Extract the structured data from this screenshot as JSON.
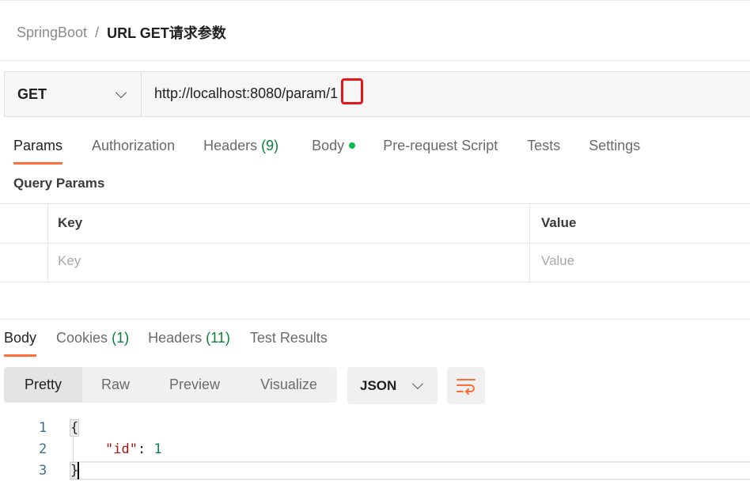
{
  "breadcrumb": {
    "parent": "SpringBoot",
    "separator": "/",
    "current": "URL GET请求参数"
  },
  "request": {
    "method": "GET",
    "url": "http://localhost:8080/param/1"
  },
  "request_tabs": [
    {
      "label": "Params",
      "count": "",
      "active": true
    },
    {
      "label": "Authorization",
      "count": ""
    },
    {
      "label": "Headers",
      "count": "(9)"
    },
    {
      "label": "Body",
      "count": "",
      "dot": true
    },
    {
      "label": "Pre-request Script",
      "count": ""
    },
    {
      "label": "Tests",
      "count": ""
    },
    {
      "label": "Settings",
      "count": ""
    }
  ],
  "query_params": {
    "title": "Query Params",
    "columns": [
      "Key",
      "Value"
    ],
    "placeholders": {
      "key": "Key",
      "value": "Value"
    }
  },
  "response_tabs": [
    {
      "label": "Body",
      "count": "",
      "active": true
    },
    {
      "label": "Cookies",
      "count": "(1)"
    },
    {
      "label": "Headers",
      "count": "(11)"
    },
    {
      "label": "Test Results",
      "count": ""
    }
  ],
  "view_modes": [
    "Pretty",
    "Raw",
    "Preview",
    "Visualize"
  ],
  "active_view_mode": "Pretty",
  "format": "JSON",
  "icons": {
    "method_dropdown": "chevron-down-icon",
    "format_dropdown": "chevron-down-icon",
    "wrap": "wrap-lines-icon",
    "body_status": "dot-indicator"
  },
  "code": {
    "line_numbers": [
      "1",
      "2",
      "3"
    ],
    "open_brace": "{",
    "key": "\"id\"",
    "colon": ": ",
    "value": "1",
    "close_brace": "}"
  },
  "colors": {
    "accent": "#ff6c37",
    "count_green": "#0a7e3b",
    "dot_green": "#0cbb52",
    "highlight_red": "#e8161b",
    "json_key": "#a31515",
    "json_number": "#098658"
  }
}
